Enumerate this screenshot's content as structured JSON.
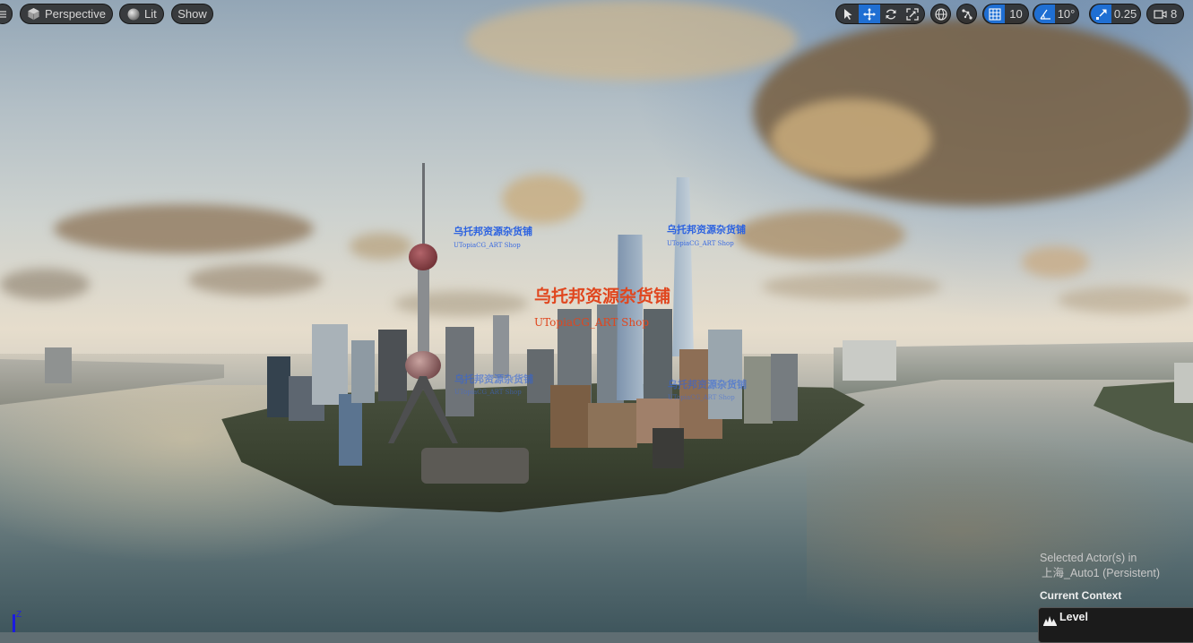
{
  "toolbar": {
    "menu_icon": "hamburger-icon",
    "view_mode": {
      "label": "Perspective",
      "icon": "cube-icon"
    },
    "lighting_mode": {
      "label": "Lit",
      "icon": "sphere-icon"
    },
    "show": {
      "label": "Show"
    },
    "transform_tools": [
      {
        "name": "select",
        "icon": "cursor-arrow-icon",
        "active": false
      },
      {
        "name": "translate",
        "icon": "move-arrows-icon",
        "active": true
      },
      {
        "name": "rotate",
        "icon": "rotate-icon",
        "active": false
      },
      {
        "name": "scale",
        "icon": "scale-icon",
        "active": false
      }
    ],
    "coordinate_system": {
      "icon": "globe-icon"
    },
    "surface_snapping": {
      "icon": "surface-snap-icon"
    },
    "grid_snap": {
      "icon": "grid-icon",
      "value": "10",
      "active": true
    },
    "rotation_snap": {
      "icon": "angle-icon",
      "value": "10°",
      "active": true
    },
    "scale_snap": {
      "icon": "scale-arrow-icon",
      "value": "0.25",
      "active": true
    },
    "camera_speed": {
      "icon": "camera-icon",
      "value": "8"
    },
    "accent_color": "#1f6fd3"
  },
  "watermarks": {
    "cn": "乌托邦资源杂货铺",
    "en": "UTopiaCG_ART Shop"
  },
  "info_overlay": {
    "selected_line1": "Selected Actor(s) in",
    "selected_line2": "上海_Auto1 (Persistent)",
    "current_context_label": "Current Context",
    "level_label": "Level"
  },
  "axis_indicator": {
    "label": "Z"
  }
}
